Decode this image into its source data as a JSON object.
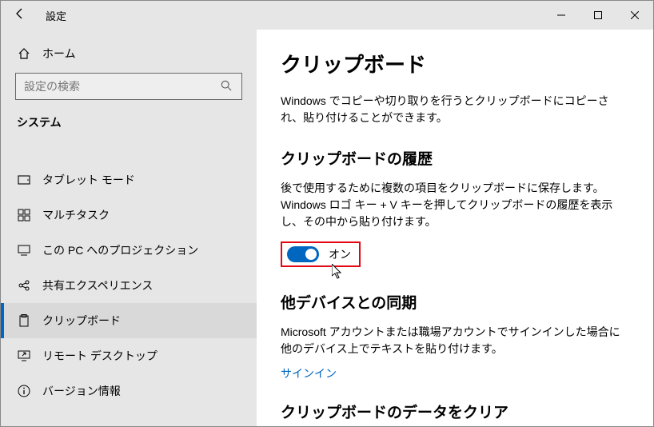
{
  "titlebar": {
    "title": "設定"
  },
  "sidebar": {
    "home": "ホーム",
    "search_placeholder": "設定の検索",
    "group": "システム",
    "items": [
      {
        "label": "タブレット モード"
      },
      {
        "label": "マルチタスク"
      },
      {
        "label": "この PC へのプロジェクション"
      },
      {
        "label": "共有エクスペリエンス"
      },
      {
        "label": "クリップボード"
      },
      {
        "label": "リモート デスクトップ"
      },
      {
        "label": "バージョン情報"
      }
    ]
  },
  "main": {
    "title": "クリップボード",
    "intro": "Windows でコピーや切り取りを行うとクリップボードにコピーされ、貼り付けることができます。",
    "history": {
      "heading": "クリップボードの履歴",
      "desc": "後で使用するために複数の項目をクリップボードに保存します。Windows ロゴ キー + V キーを押してクリップボードの履歴を表示し、その中から貼り付けます。",
      "toggle_label": "オン",
      "toggle_state": true
    },
    "sync": {
      "heading": "他デバイスとの同期",
      "desc": "Microsoft アカウントまたは職場アカウントでサインインした場合に他のデバイス上でテキストを貼り付けます。",
      "link": "サインイン"
    },
    "clear": {
      "heading": "クリップボードのデータをクリア"
    }
  }
}
